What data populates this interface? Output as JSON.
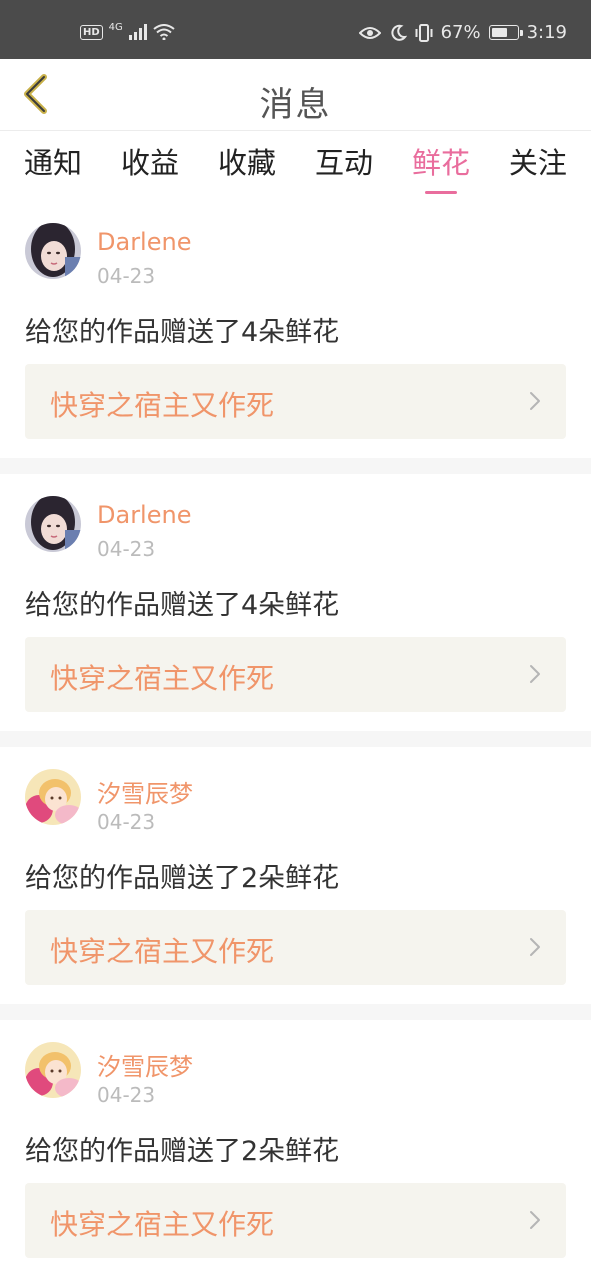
{
  "status_bar": {
    "left_badge": "HD",
    "network": "4G",
    "battery_percent": "67%",
    "battery_level": 0.67,
    "time": "3:19"
  },
  "header": {
    "title": "消息"
  },
  "tabs": [
    {
      "label": "通知",
      "active": false
    },
    {
      "label": "收益",
      "active": false
    },
    {
      "label": "收藏",
      "active": false
    },
    {
      "label": "互动",
      "active": false
    },
    {
      "label": "鲜花",
      "active": true
    },
    {
      "label": "关注",
      "active": false
    }
  ],
  "items": [
    {
      "user": "Darlene",
      "date": "04-23",
      "message": "给您的作品赠送了4朵鲜花",
      "work": "快穿之宿主又作死",
      "avatar_style": "dark"
    },
    {
      "user": "Darlene",
      "date": "04-23",
      "message": "给您的作品赠送了4朵鲜花",
      "work": "快穿之宿主又作死",
      "avatar_style": "dark"
    },
    {
      "user": "汐雪辰梦",
      "date": "04-23",
      "message": "给您的作品赠送了2朵鲜花",
      "work": "快穿之宿主又作死",
      "avatar_style": "pink"
    },
    {
      "user": "汐雪辰梦",
      "date": "04-23",
      "message": "给您的作品赠送了2朵鲜花",
      "work": "快穿之宿主又作死",
      "avatar_style": "pink"
    }
  ],
  "colors": {
    "accent": "#e96d9d",
    "name": "#f0956a",
    "work_bg": "#f5f4ee",
    "status_bar": "#4b4b4b"
  }
}
